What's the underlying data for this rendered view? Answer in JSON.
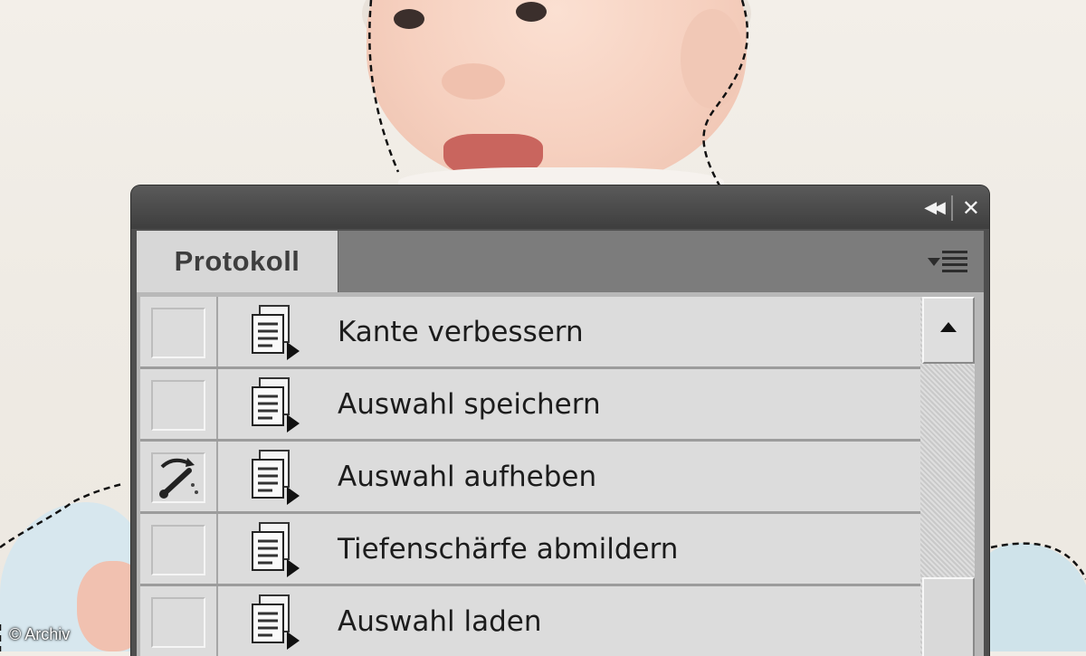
{
  "photo": {
    "credit": "© Archiv"
  },
  "panel": {
    "title_controls": {
      "collapse_glyph": "◀◀",
      "close_glyph": "✕"
    },
    "tab_label": "Protokoll",
    "menu_icon": "panel-menu-icon",
    "history_items": [
      {
        "label": "Kante verbessern",
        "history_brush": false,
        "selected": false
      },
      {
        "label": "Auswahl speichern",
        "history_brush": false,
        "selected": false
      },
      {
        "label": "Auswahl aufheben",
        "history_brush": true,
        "selected": false
      },
      {
        "label": "Tiefenschärfe abmildern",
        "history_brush": false,
        "selected": false
      },
      {
        "label": "Auswahl laden",
        "history_brush": false,
        "selected": false
      }
    ]
  },
  "colors": {
    "panel_dark": "#4f4f4f",
    "row_bg": "#dcdcdc",
    "selected_row": "#1e2f6a"
  }
}
